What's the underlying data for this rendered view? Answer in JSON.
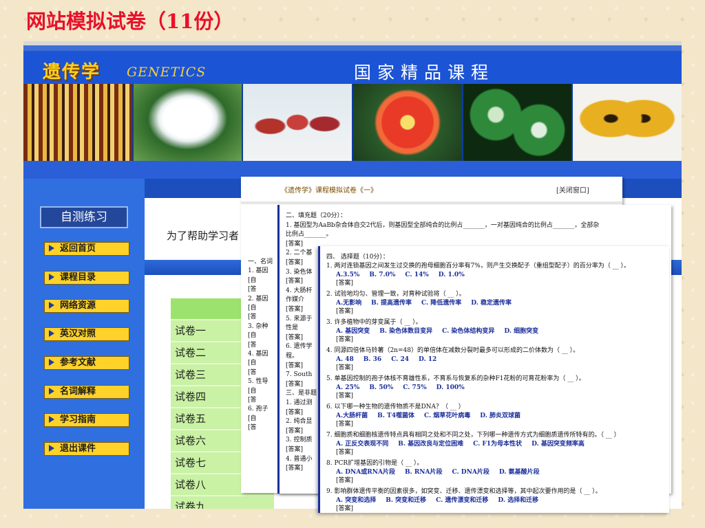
{
  "slide_title": "网站模拟试卷（11份）",
  "site": {
    "logo": "遗传学",
    "logo_en": "GENETICS",
    "course_name": "国家精品课程",
    "colors": {
      "header": "#1c54d6",
      "nav": "#ffd22a",
      "list": "#c9f2a4"
    },
    "photos": [
      "corn-photo",
      "cotton-photo",
      "corn-cob-photo",
      "flower-photo",
      "plant-photo",
      "butterfly-photo"
    ]
  },
  "sidebar": {
    "heading": "自测练习",
    "items": [
      {
        "label": "返回首页"
      },
      {
        "label": "课程目录"
      },
      {
        "label": "网络资源"
      },
      {
        "label": "英汉对照"
      },
      {
        "label": "参考文献"
      },
      {
        "label": "名词解释"
      },
      {
        "label": "学习指南"
      },
      {
        "label": "退出课件"
      }
    ]
  },
  "content": {
    "intro": "为了帮助学习者",
    "list_header": "试",
    "papers": [
      "试卷一",
      "试卷二",
      "试卷三",
      "试卷四",
      "试卷五",
      "试卷六",
      "试卷七",
      "试卷八",
      "试卷九"
    ]
  },
  "popup1": {
    "title": "《遗传学》课程模拟试卷《一》",
    "close": "[关闭窗口]"
  },
  "popup2": {
    "lines": [
      "一、名词",
      "1.  基因",
      "    [自",
      "    [答",
      "2.  基因",
      "    [自",
      "    [答",
      "3.  杂种",
      "    [自",
      "    [答",
      "4.  基因",
      "    [自",
      "    [答",
      "5.  性导",
      "    [自",
      "    [答",
      "6.  孢子",
      "    [自",
      "    [答"
    ],
    "lines2": [
      "二、填充题（20分）：",
      "1.  基因型为AaBb杂合体自交2代后，则基因型全部纯合的比例占_______，一对基因纯合的比例占_______，全部杂",
      "    比例占_______。",
      "    [答案]",
      "2.  二个基",
      "    [答案]",
      "3.  染色体",
      "    [答案]",
      "4.  大肠杆",
      "    作媒介",
      "    [答案]",
      "5.  来源于",
      "    性是",
      "    [答案]",
      "6.  遗传学",
      "    程。",
      "    [答案]",
      "7.  South",
      "    [答案]",
      "三、是非题",
      "1.  通过测",
      "    [答案]",
      "2.  纯合显",
      "    [答案]",
      "3.  控制质",
      "    [答案]",
      "4.  普通小",
      "    [答案]"
    ]
  },
  "popup3": {
    "questions": [
      {
        "q": "四、  选择题（10分）：",
        "opts": [],
        "ans": ""
      },
      {
        "q": "1.  两对连锁基因之间发生过交换的孢母细胞百分率有7%，则产生交换配子（重组型配子）的百分率为（ __ ）。",
        "opts": [
          "A.3.5%",
          "B. 7.0%",
          "C. 14%",
          "D. 1.0%"
        ],
        "ans": "[答案]"
      },
      {
        "q": "2.  试验地均匀、管理一致，对育种试验将（ __ ）。",
        "opts": [
          "A.无影响",
          "B. 提高遗传率",
          "C. 降低遗传率",
          "D. 稳定遗传率"
        ],
        "ans": "[答案]"
      },
      {
        "q": "3.  许多植物中的芽变属于（ __ ）。",
        "opts": [
          "A. 基因突变",
          "B. 染色体数目变异",
          "C. 染色体结构变异",
          "D. 细胞突变"
        ],
        "ans": "[答案]"
      },
      {
        "q": "4.  同源四倍体马铃薯（2n=48）的单倍体在减数分裂时最多可以形成的二价体数为（ __ ）。",
        "opts": [
          "A. 48",
          "B. 36",
          "C. 24",
          "D. 12"
        ],
        "ans": "[答案]"
      },
      {
        "q": "5.  单基因控制的孢子体核不育雄性系，不育系与恢复系的杂种F1花粉的可育花粉率为（ __ ）。",
        "opts": [
          "A. 25%",
          "B. 50%",
          "C. 75%",
          "D. 100%"
        ],
        "ans": "[答案]"
      },
      {
        "q": "6.  以下哪一种生物的遗传物质不是DNA？（ __ ）",
        "opts": [
          "A.大肠杆菌",
          "B. T4噬菌体",
          "C. 烟草花叶病毒",
          "D. 肺炎双球菌"
        ],
        "ans": "[答案]"
      },
      {
        "q": "7.  细胞质和细胞核遗传特点具有相同之处和不同之处，下列哪一种遗传方式为细胞质遗传所特有的。（ __ ）",
        "opts": [
          "A. 正反交表现不同",
          "B. 基因改良与定位困难",
          "C. F1为母本性状",
          "D. 基因突变频率高"
        ],
        "ans": "[答案]"
      },
      {
        "q": "8.  PCR扩增基因的引物是（ __ ）。",
        "opts": [
          "A. DNA或RNA片段",
          "B. RNA片段",
          "C. DNA片段",
          "D. 氨基酸片段"
        ],
        "ans": "[答案]"
      },
      {
        "q": "9.  影响群体遗传平衡的因素很多，如突变、迁移、遗传漂变和选择等，其中起次要作用的是（ __ ）。",
        "opts": [
          "A. 突变和选择",
          "B. 突变和迁移",
          "C. 遗传漂变和迁移",
          "D. 选择和迁移"
        ],
        "ans": "[答案]"
      }
    ]
  }
}
